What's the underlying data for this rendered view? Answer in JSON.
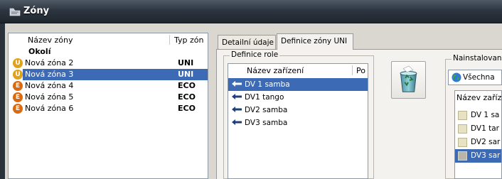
{
  "window": {
    "title": "Zóny"
  },
  "zone_list": {
    "columns": [
      "Název zóny",
      "Typ zón"
    ],
    "rows": [
      {
        "name": "Okolí",
        "type": "",
        "icon": "",
        "bold": true
      },
      {
        "name": "Nová zóna 2",
        "type": "UNI",
        "icon": "U"
      },
      {
        "name": "Nová zóna 3",
        "type": "UNI",
        "icon": "U",
        "selected": true
      },
      {
        "name": "Nová zóna 4",
        "type": "ECO",
        "icon": "E"
      },
      {
        "name": "Nová zóna 5",
        "type": "ECO",
        "icon": "E"
      },
      {
        "name": "Nová zóna 6",
        "type": "ECO",
        "icon": "E"
      }
    ],
    "icon_colors": {
      "U": "#e0a11b",
      "E": "#d96a10"
    }
  },
  "tabs": [
    {
      "label": "Detailní údaje"
    },
    {
      "label": "Definice zóny UNI",
      "active": true
    }
  ],
  "role_group": {
    "label": "Definice role",
    "columns": [
      "Název zařízení",
      "Po"
    ],
    "rows": [
      {
        "name": "DV 1 samba",
        "selected": true
      },
      {
        "name": "DV1 tango"
      },
      {
        "name": "DV2 samba"
      },
      {
        "name": "DV3 samba"
      }
    ]
  },
  "installed_group": {
    "label": "Nainstalovaná",
    "combo_value": "Všechna",
    "columns": [
      "Název zaříz"
    ],
    "rows": [
      {
        "name": "DV 1 sa"
      },
      {
        "name": "DV1 tar"
      },
      {
        "name": "DV2 sar"
      },
      {
        "name": "DV3 sar",
        "selected": true
      }
    ]
  },
  "icons": {
    "title": "zone-window-icon",
    "delete": "recycle-bin-icon",
    "combo": "globe-icon",
    "device": "arrow-device-icon"
  }
}
